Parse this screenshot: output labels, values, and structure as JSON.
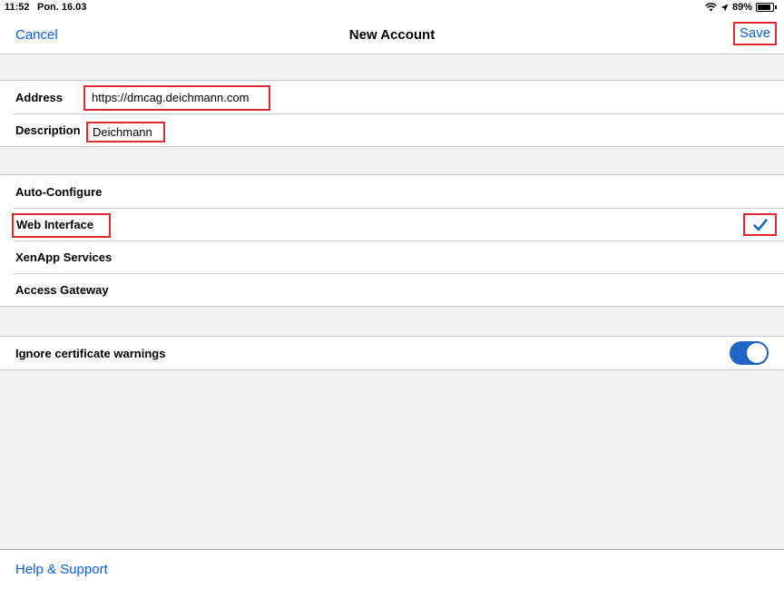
{
  "status_bar": {
    "time": "11:52",
    "date": "Pon. 16.03",
    "battery_text": "89%",
    "battery_level": 0.89,
    "icons": [
      "wifi-icon",
      "location-arrow-icon",
      "battery-icon"
    ]
  },
  "nav": {
    "cancel": "Cancel",
    "title": "New Account",
    "save": "Save"
  },
  "account": {
    "address_label": "Address",
    "address_value": "https://dmcag.deichmann.com",
    "description_label": "Description",
    "description_value": "Deichmann"
  },
  "account_type": {
    "options": [
      "Auto-Configure",
      "Web Interface",
      "XenApp Services",
      "Access Gateway"
    ],
    "selected": "Web Interface"
  },
  "settings": {
    "ignore_cert_label": "Ignore certificate warnings",
    "ignore_cert_on": true
  },
  "footer": {
    "help": "Help & Support"
  },
  "colors": {
    "accent": "#0a60d0",
    "highlight_border": "#e0282e",
    "toggle_on": "#1f66c8",
    "background": "#efeff4"
  }
}
